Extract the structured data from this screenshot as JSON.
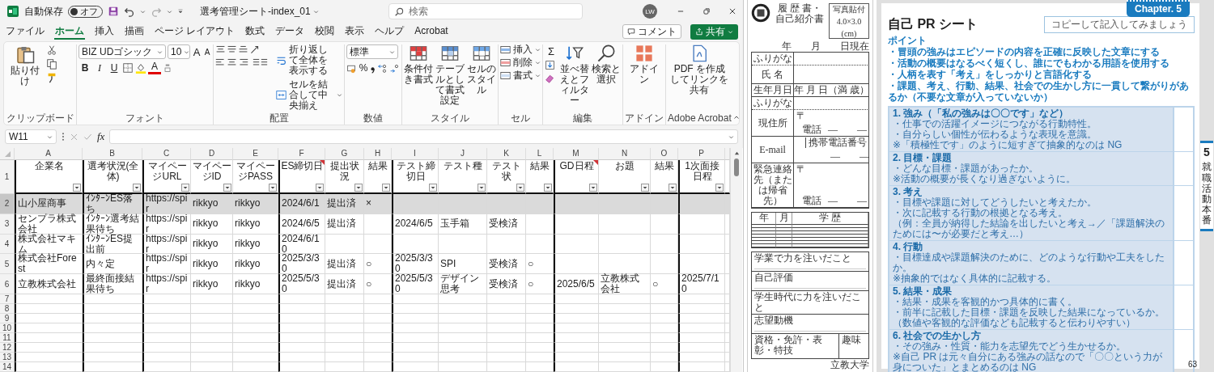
{
  "excel": {
    "title_bar": {
      "autosave_label": "自動保存",
      "autosave": {
        "on": false,
        "label": "オフ"
      },
      "file_name": "選考管理シート-index_01",
      "search": {
        "placeholder": "検索"
      },
      "avatar": "LW"
    },
    "menu_tabs": [
      {
        "label": "ファイル",
        "selected": false
      },
      {
        "label": "ホーム",
        "selected": true
      },
      {
        "label": "挿入",
        "selected": false
      },
      {
        "label": "描画",
        "selected": false
      },
      {
        "label": "ページ レイアウト",
        "selected": false
      },
      {
        "label": "数式",
        "selected": false
      },
      {
        "label": "データ",
        "selected": false
      },
      {
        "label": "校閲",
        "selected": false
      },
      {
        "label": "表示",
        "selected": false
      },
      {
        "label": "ヘルプ",
        "selected": false
      },
      {
        "label": "Acrobat",
        "selected": false
      }
    ],
    "comment_button": "コメント",
    "share_button": "共有",
    "ribbon": {
      "clipboard": {
        "paste": "貼り付け",
        "label": "クリップボード"
      },
      "font": {
        "font_name": "BIZ UDゴシック",
        "font_size": "10",
        "size_buttons": [
          "A",
          "A"
        ],
        "format_buttons": [
          "B",
          "I",
          "U"
        ],
        "color_button": "A",
        "label": "フォント"
      },
      "alignment": {
        "wrap_text": "折り返して全体を表示する",
        "merge_center": "セルを結合して中央揃え",
        "label": "配置"
      },
      "number": {
        "format": "標準",
        "percent": "%",
        "label": "数値"
      },
      "styles": {
        "buttons": [
          "条件付き書式",
          "テーブルとして書式設定",
          "セルのスタイル"
        ],
        "label": "スタイル"
      },
      "cells": {
        "buttons": [
          "挿入",
          "削除",
          "書式"
        ],
        "label": "セル"
      },
      "editing": {
        "autosum": "Σ",
        "buttons": [
          "並べ替えとフィルター",
          "検索と選択"
        ],
        "label": "編集"
      },
      "addins": {
        "button": "アドイン",
        "label": "アドイン"
      },
      "acrobat": {
        "button": "PDF を作成してリンクを共有",
        "label": "Adobe Acrobat"
      }
    },
    "formula_bar": {
      "name_box": "W11",
      "fx": "fx"
    },
    "sheet": {
      "column_letters": [
        "A",
        "B",
        "C",
        "D",
        "E",
        "F",
        "G",
        "H",
        "I",
        "J",
        "K",
        "L",
        "M",
        "N",
        "O",
        "P"
      ],
      "header_row_number": "1",
      "columns": [
        {
          "header": "企業名",
          "filter": true,
          "comment": false
        },
        {
          "header": "選考状況(全体)",
          "filter": true,
          "comment": false
        },
        {
          "header": "マイページURL",
          "filter": true,
          "comment": false
        },
        {
          "header": "マイページID",
          "filter": true,
          "comment": false
        },
        {
          "header": "マイページPASS",
          "filter": true,
          "comment": false
        },
        {
          "header": "ES締切日",
          "filter": true,
          "comment": true
        },
        {
          "header": "提出状況",
          "filter": true,
          "comment": false
        },
        {
          "header": "結果",
          "filter": true,
          "comment": false
        },
        {
          "header": "テスト締切日",
          "filter": true,
          "comment": false
        },
        {
          "header": "テスト種",
          "filter": true,
          "comment": false
        },
        {
          "header": "テスト状",
          "filter": true,
          "comment": false
        },
        {
          "header": "結果",
          "filter": true,
          "comment": false
        },
        {
          "header": "GD日程",
          "filter": true,
          "comment": true
        },
        {
          "header": "お題",
          "filter": true,
          "comment": false
        },
        {
          "header": "結果",
          "filter": true,
          "comment": false
        },
        {
          "header": "1次面接日程",
          "filter": true,
          "comment": false
        }
      ],
      "rows": [
        {
          "number": "2",
          "highlighted": true,
          "cells": [
            "山小屋商事",
            "ｲﾝﾀｰﾝES落ち",
            "https://spir",
            "rikkyo",
            "rikkyo",
            "2024/6/1",
            "提出済",
            "×",
            null,
            null,
            null,
            null,
            null,
            null,
            null,
            null
          ]
        },
        {
          "number": "3",
          "highlighted": false,
          "cells": [
            "センプラ株式会社",
            "ｲﾝﾀｰﾝ選考結果待ち",
            "https://spir",
            "rikkyo",
            "rikkyo",
            "2024/6/5",
            "提出済",
            null,
            "2024/6/5",
            "玉手箱",
            "受検済",
            null,
            null,
            null,
            null,
            null
          ]
        },
        {
          "number": "4",
          "highlighted": false,
          "cells": [
            "株式会社マキム",
            "ｲﾝﾀｰﾝES提出前",
            "https://spir",
            "rikkyo",
            "rikkyo",
            "2024/6/10",
            null,
            null,
            null,
            null,
            null,
            null,
            null,
            null,
            null,
            null
          ]
        },
        {
          "number": "5",
          "highlighted": false,
          "cells": [
            "株式会社Forest",
            "内々定",
            "https://spir",
            "rikkyo",
            "rikkyo",
            "2025/3/30",
            "提出済",
            "○",
            "2025/3/30",
            "SPI",
            "受検済",
            "○",
            null,
            null,
            null,
            null
          ]
        },
        {
          "number": "6",
          "highlighted": false,
          "cells": [
            "立教株式会社",
            "最終面接結果待ち",
            "https://spir",
            "rikkyo",
            "rikkyo",
            "2025/5/30",
            "提出済",
            "○",
            "2025/5/30",
            "デザイン思考",
            "受検済",
            "○",
            "2025/6/5",
            "立教株式会社",
            "○",
            "2025/7/10"
          ]
        }
      ],
      "empty_row_numbers": [
        "7",
        "8",
        "9",
        "10",
        "11",
        "12",
        "13",
        "14"
      ]
    }
  },
  "resume": {
    "title": "履 歴 書・自己紹介書",
    "date": "年　　月　　日現在",
    "photo": {
      "label": "写真貼付",
      "size": "4.0×3.0",
      "unit": "(cm)"
    },
    "personal_rows": [
      {
        "kind": "furigana",
        "label": "ふりがな"
      },
      {
        "kind": "name",
        "label": "氏 名"
      },
      {
        "kind": "birth",
        "label": "生年月日",
        "value": "年 月 日（満 歳）"
      },
      {
        "kind": "furigana",
        "label": "ふりがな"
      },
      {
        "kind": "address",
        "label": "現住所",
        "postal": "〒",
        "phone": "電話",
        "phone_blanks": "—　　—"
      },
      {
        "kind": "email",
        "label": "E-mail",
        "mobile_label": "携帯電話番号",
        "phone_blanks": "—　　—"
      },
      {
        "kind": "address",
        "label": "緊急連絡先（または帰省先）",
        "postal": "〒",
        "phone": "電話",
        "phone_blanks": "—　　—"
      }
    ],
    "education_header": [
      "年",
      "月",
      "学 歴"
    ],
    "sections": [
      "学業で力を注いだこと",
      "自己評価",
      "学生時代に力を注いだこと",
      "志望動機"
    ],
    "bottom_boxes": [
      "資格・免許・表彰・特技",
      "趣味"
    ],
    "footer": "立教大学"
  },
  "pr_sheet": {
    "chapter": "Chapter. 5",
    "title": "自己 PR シート",
    "copy_note": "コピーして記入してみましょう",
    "points_label": "ポイント",
    "points": [
      "・冒頭の強みはエピソードの内容を正確に反映した文章にする",
      "・活動の概要はなるべく短くし、誰にでもわかる用語を使用する",
      "・人柄を表す「考え」をしっかりと言語化する",
      "・課題、考え、行動、結果、社会での生かし方に一貫して繋がりがあるか（不要な文章が入っていないか）"
    ],
    "sections": [
      {
        "title": "1. 強み（「私の強みは〇〇です」など）",
        "notes": [
          "・仕事での活躍イメージにつながる行動特性。",
          "・自分らしい個性が伝わるような表現を意識。",
          "※「積極性です」のように短すぎて抽象的なのは NG"
        ]
      },
      {
        "title": "2. 目標・課題",
        "notes": [
          "・どんな目標・課題があったか。",
          "※活動の概要が長くなり過ぎないように。"
        ]
      },
      {
        "title": "3. 考え",
        "notes": [
          "・目標や課題に対してどうしたいと考えたか。",
          "・次に記載する行動の根拠となる考え。",
          "（例：全員が納得した結論を出したいと考え→／「課題解決のためには〜が必要だと考え…）"
        ]
      },
      {
        "title": "4. 行動",
        "notes": [
          "・目標達成や課題解決のために、どのような行動や工夫をしたか。",
          "※抽象的ではなく具体的に記載する。"
        ]
      },
      {
        "title": "5. 結果・成果",
        "notes": [
          "・結果・成果を客観的かつ具体的に書く。",
          "・前半に記載した目標・課題を反映した結果になっているか。",
          "（数値や客観的な評価なども記載すると伝わりやすい）"
        ]
      },
      {
        "title": "6. 社会での生かし方",
        "notes": [
          "・その強み・性質・能力を志望先でどう生かせるか。",
          "※自己 PR は元々自分にある強みの話なので「〇〇という力が身についた」とまとめるのは NG"
        ]
      }
    ],
    "side_tab": {
      "number": "5",
      "label": "就職活動本番"
    },
    "page_number": "63"
  }
}
